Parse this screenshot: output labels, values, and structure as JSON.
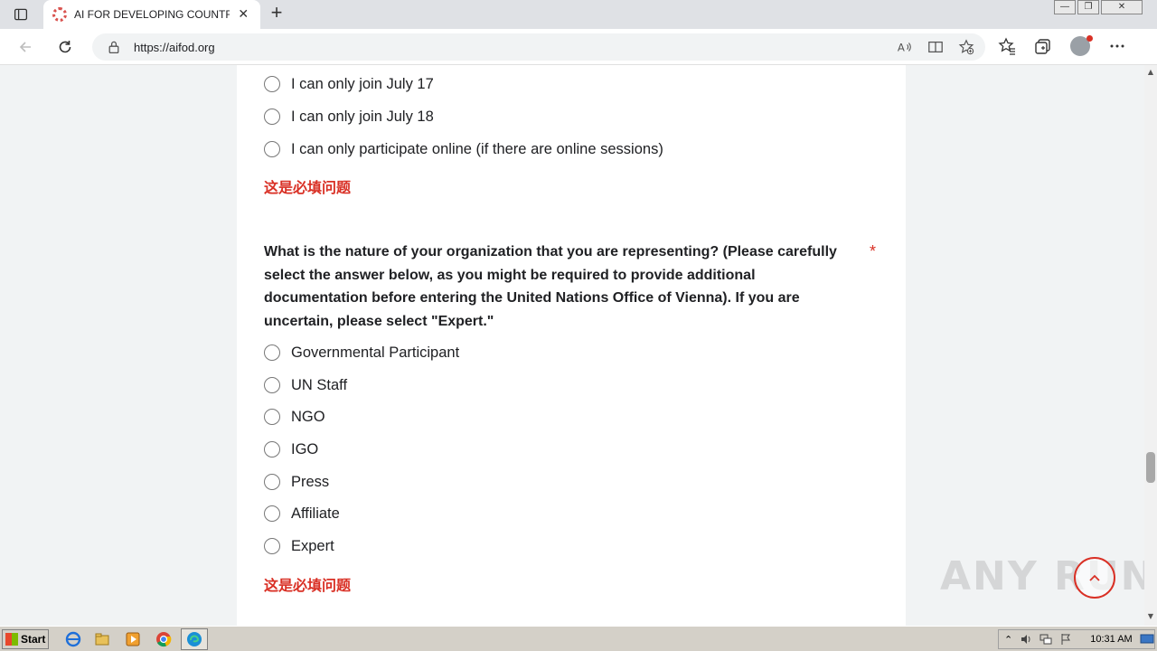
{
  "browser": {
    "tab_title": "AI FOR DEVELOPING COUNTRIES",
    "tab_close": "✕",
    "new_tab": "+",
    "url": "https://aifod.org",
    "window_controls": {
      "minimize": "—",
      "maximize": "❐",
      "close": "✕"
    }
  },
  "form": {
    "previous_question_options": [
      {
        "label": "I can only join July 17"
      },
      {
        "label": "I can only join July 18"
      },
      {
        "label": "I can only participate online (if there are online sessions)"
      }
    ],
    "required_error": "这是必填问题",
    "question": {
      "text": "What is the nature of your organization that you are representing? (Please carefully select the answer below, as you might be required to provide additional documentation before entering the United Nations Office of Vienna). If you are uncertain, please select \"Expert.\"",
      "required_marker": "*"
    },
    "options": [
      {
        "label": "Governmental Participant"
      },
      {
        "label": "UN Staff"
      },
      {
        "label": "NGO"
      },
      {
        "label": "IGO"
      },
      {
        "label": "Press"
      },
      {
        "label": "Affiliate"
      },
      {
        "label": "Expert"
      }
    ],
    "required_error_2": "这是必填问题"
  },
  "overlay": {
    "watermark": "ANY RUN"
  },
  "taskbar": {
    "start_label": "Start",
    "clock": "10:31 AM"
  },
  "colors": {
    "accent_red": "#d93025",
    "page_bg": "#f1f3f4",
    "card_bg": "#ffffff"
  }
}
